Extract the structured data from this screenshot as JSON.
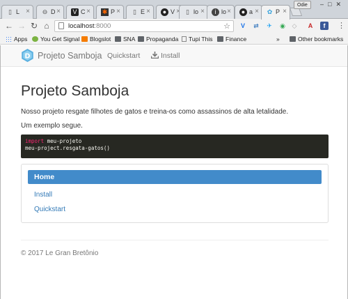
{
  "browser": {
    "tabs": [
      {
        "icon": "page-icon",
        "label": "L"
      },
      {
        "icon": "globe-icon",
        "label": "D"
      },
      {
        "icon": "shield-icon",
        "label": "C"
      },
      {
        "icon": "star-icon",
        "label": "P"
      },
      {
        "icon": "page-icon",
        "label": "E"
      },
      {
        "icon": "github-icon",
        "label": "V"
      },
      {
        "icon": "page-icon",
        "label": "lo"
      },
      {
        "icon": "info-icon",
        "label": "lo"
      },
      {
        "icon": "github-icon",
        "label": "a"
      },
      {
        "icon": "logo-icon",
        "label": "P"
      }
    ],
    "active_tab_index": 9,
    "profile_name": "Odie",
    "url_host": "localhost",
    "url_port": ":8000",
    "bookmarks": [
      {
        "icon": "apps-icon",
        "label": "Apps"
      },
      {
        "icon": "leaf-icon",
        "label": "You Get Signal"
      },
      {
        "icon": "bookmark-icon",
        "label": "Blogslot"
      },
      {
        "icon": "folder-icon",
        "label": "SNA"
      },
      {
        "icon": "folder-icon",
        "label": "Propaganda"
      },
      {
        "icon": "page-icon",
        "label": "Tupi This"
      },
      {
        "icon": "folder-icon",
        "label": "Finance"
      }
    ],
    "bookmarks_overflow": "»",
    "other_bookmarks": "Other bookmarks"
  },
  "site": {
    "brand": "Projeto Samboja",
    "nav": [
      {
        "label": "Quickstart"
      },
      {
        "label": "Install"
      }
    ],
    "title": "Projeto Samboja",
    "intro": "Nosso projeto resgate filhotes de gatos e treina-os como assassinos de alta letalidade.",
    "example_label": "Um exemplo segue.",
    "code": {
      "line1_keyword": "import",
      "line1_rest": " meu-projeto",
      "line2": "meu-project.resgata-gatos()"
    },
    "menu": {
      "active": "Home",
      "items": [
        "Install",
        "Quickstart"
      ]
    },
    "footer": "© 2017 Le Gran Bretônio",
    "accent": "#428bca",
    "link_color": "#337ab7",
    "code_bg": "#272822"
  }
}
